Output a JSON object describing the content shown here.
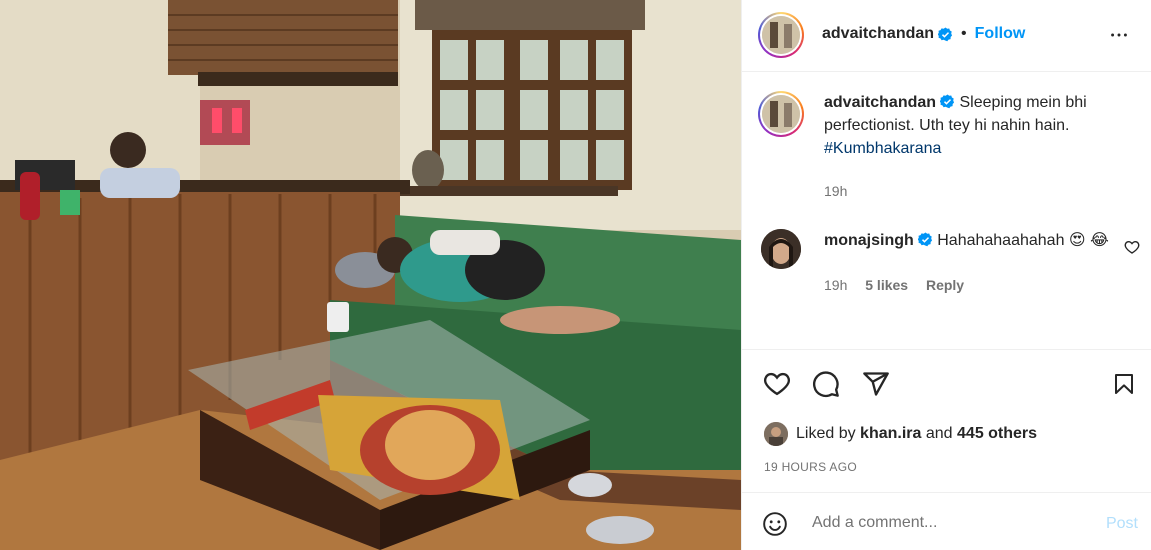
{
  "post": {
    "username": "advaitchandan",
    "follow_label": "Follow",
    "separator": "•"
  },
  "caption": {
    "username": "advaitchandan",
    "text": "Sleeping mein bhi perfectionist. Uth tey hi nahin hain.",
    "hashtag": "#Kumbhakarana",
    "time": "19h"
  },
  "comments": [
    {
      "username": "monajsingh",
      "text": "Hahahahaahahah",
      "emoji_1": "😍",
      "emoji_2": "😂",
      "time": "19h",
      "likes": "5 likes",
      "reply_label": "Reply"
    }
  ],
  "likes": {
    "prefix": "Liked by",
    "user": "khan.ira",
    "middle": "and",
    "others": "445 others"
  },
  "timestamp": "19 HOURS AGO",
  "comment_box": {
    "placeholder": "Add a comment...",
    "post_label": "Post"
  },
  "icons": {
    "more": "more-horizontal-icon",
    "heart": "heart-icon",
    "comment": "comment-icon",
    "share": "share-icon",
    "save": "bookmark-icon",
    "emoji": "emoji-icon",
    "verified": "verified-badge-icon"
  },
  "colors": {
    "accent": "#0095f6",
    "text": "#262626",
    "muted": "#737373",
    "border": "#efefef",
    "hashtag": "#00376b",
    "post_disabled": "#b2dffc",
    "verified": "#0095f6",
    "sofa": "#3f7f4e"
  }
}
